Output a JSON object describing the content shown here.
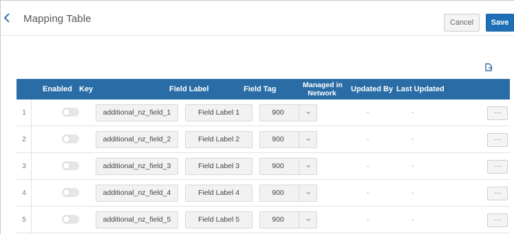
{
  "header": {
    "title": "Mapping Table",
    "cancel_label": "Cancel",
    "save_label": "Save"
  },
  "table": {
    "columns": {
      "enabled": "Enabled",
      "key": "Key",
      "field_label": "Field Label",
      "field_tag": "Field Tag",
      "managed_line1": "Managed in",
      "managed_line2": "Network",
      "updated_by": "Updated By",
      "last_updated": "Last Updated"
    },
    "rows": [
      {
        "num": "1",
        "enabled": false,
        "key": "additional_nz_field_1",
        "field_label": "Field Label 1",
        "field_tag": "900",
        "updated_by": "-",
        "last_updated": "-",
        "more": "···"
      },
      {
        "num": "2",
        "enabled": false,
        "key": "additional_nz_field_2",
        "field_label": "Field Label 2",
        "field_tag": "900",
        "updated_by": "-",
        "last_updated": "-",
        "more": "···"
      },
      {
        "num": "3",
        "enabled": false,
        "key": "additional_nz_field_3",
        "field_label": "Field Label 3",
        "field_tag": "900",
        "updated_by": "-",
        "last_updated": "-",
        "more": "···"
      },
      {
        "num": "4",
        "enabled": false,
        "key": "additional_nz_field_4",
        "field_label": "Field Label 4",
        "field_tag": "900",
        "updated_by": "-",
        "last_updated": "-",
        "more": "···"
      },
      {
        "num": "5",
        "enabled": false,
        "key": "additional_nz_field_5",
        "field_label": "Field Label 5",
        "field_tag": "900",
        "updated_by": "-",
        "last_updated": "-",
        "more": "···"
      }
    ]
  },
  "icons": {
    "back": "chevron-left-icon",
    "export": "export-icon",
    "dropdown": "chevron-down-icon"
  },
  "colors": {
    "header_bg": "#2a6da6",
    "save_bg": "#1f6fb6"
  }
}
